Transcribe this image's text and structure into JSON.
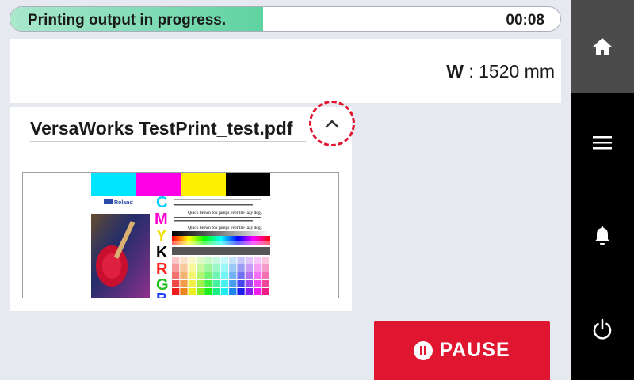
{
  "status": {
    "message": "Printing output in progress.",
    "time": "00:08",
    "progress_fraction": 0.46,
    "fill_color": "#5fd2a1"
  },
  "media": {
    "width_key": "W",
    "width_value": "1520 mm"
  },
  "job": {
    "filename": "VersaWorks TestPrint_test.pdf",
    "collapse_icon": "chevron-up-icon",
    "preview_brand": "Roland",
    "preview_letters": [
      "C",
      "M",
      "Y",
      "K",
      "R",
      "G",
      "B"
    ],
    "preview_text_lines": [
      "Quick brown fox jumps over the lazy dog.",
      "Quick brown fox jumps over the lazy dog."
    ]
  },
  "actions": {
    "pause_label": "PAUSE",
    "accent_color": "#e0152f"
  },
  "sidebar": {
    "items": [
      {
        "name": "home",
        "icon": "home-icon",
        "active": true
      },
      {
        "name": "menu",
        "icon": "menu-icon",
        "active": false
      },
      {
        "name": "notifications",
        "icon": "bell-icon",
        "active": false
      },
      {
        "name": "power",
        "icon": "power-icon",
        "active": false
      }
    ]
  }
}
